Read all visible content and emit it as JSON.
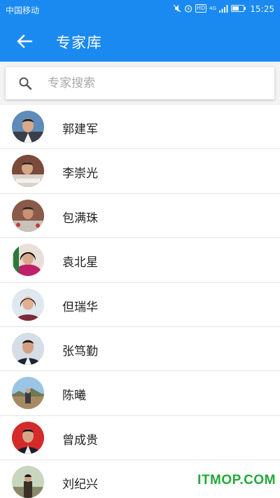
{
  "status_bar": {
    "carrier": "中国移动",
    "time": "15:25",
    "hd": "HD",
    "network": "4G"
  },
  "header": {
    "title": "专家库",
    "back_icon": "arrow-left-icon"
  },
  "search": {
    "placeholder": "专家搜索",
    "value": "",
    "icon": "search-icon"
  },
  "experts": [
    {
      "name": "郭建军"
    },
    {
      "name": "李崇光"
    },
    {
      "name": "包满珠"
    },
    {
      "name": "袁北星"
    },
    {
      "name": "但瑞华"
    },
    {
      "name": "张笃勤"
    },
    {
      "name": "陈曦"
    },
    {
      "name": "曾成贵"
    },
    {
      "name": "刘纪兴"
    }
  ],
  "watermark": "ITMOP.COM",
  "colors": {
    "accent": "#1b8af0",
    "watermark": "#22a83a"
  }
}
